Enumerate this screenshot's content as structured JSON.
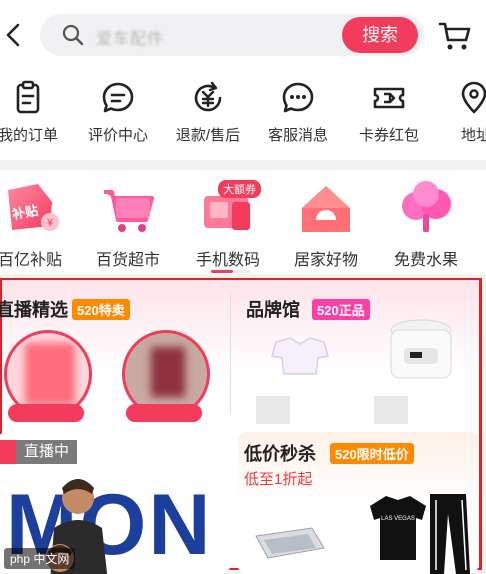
{
  "header": {
    "search_placeholder": "爱车配件",
    "search_button": "搜索"
  },
  "orders": [
    {
      "label": "我的订单",
      "icon": "clipboard-icon"
    },
    {
      "label": "评价中心",
      "icon": "comment-icon"
    },
    {
      "label": "退款/售后",
      "icon": "refund-icon"
    },
    {
      "label": "客服消息",
      "icon": "chat-icon"
    },
    {
      "label": "卡券红包",
      "icon": "ticket-icon"
    },
    {
      "label": "地址",
      "icon": "location-icon"
    }
  ],
  "categories": [
    {
      "label": "百亿补贴",
      "badge": "补贴"
    },
    {
      "label": "百货超市"
    },
    {
      "label": "手机数码",
      "badge": "大额券"
    },
    {
      "label": "居家好物"
    },
    {
      "label": "免费水果"
    }
  ],
  "promo": {
    "live_pick": {
      "title": "直播精选",
      "tag": "520特卖"
    },
    "brand": {
      "title": "品牌馆",
      "tag": "520正品"
    },
    "live": {
      "badge": "直播中",
      "banner": "IMON"
    },
    "flash": {
      "title": "低价秒杀",
      "tag": "520限时低价",
      "subtitle": "低至1折起"
    }
  },
  "watermark": "php 中文网",
  "colors": {
    "accent": "#f33b5b",
    "highlight_border": "#e3211f"
  }
}
